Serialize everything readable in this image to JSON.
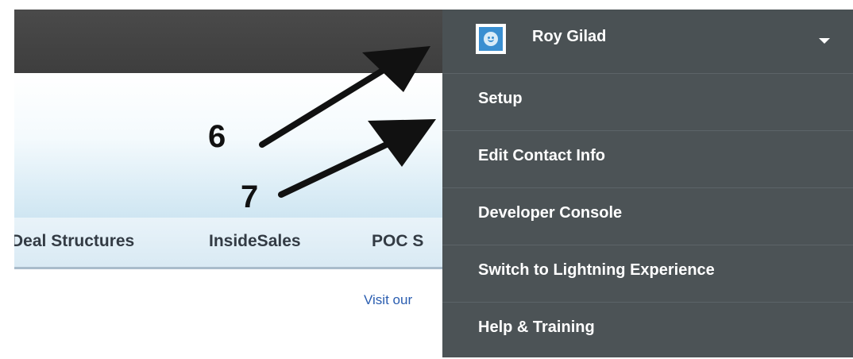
{
  "background_page": {
    "tabs": [
      "Deal Structures",
      "InsideSales",
      "POC S"
    ],
    "visit_link": "Visit our"
  },
  "annotations": {
    "labels": [
      "6",
      "7"
    ]
  },
  "user_menu": {
    "user_name": "Roy Gilad",
    "avatar_icon": "user-avatar-icon",
    "toggle_icon": "caret-down-icon",
    "items": [
      {
        "label": "Setup"
      },
      {
        "label": "Edit Contact Info"
      },
      {
        "label": "Developer Console"
      },
      {
        "label": "Switch to Lightning Experience"
      },
      {
        "label": "Help & Training"
      }
    ]
  },
  "colors": {
    "menu_background": "#4c5356",
    "header_bar": "#444444",
    "link": "#2a5db0"
  }
}
